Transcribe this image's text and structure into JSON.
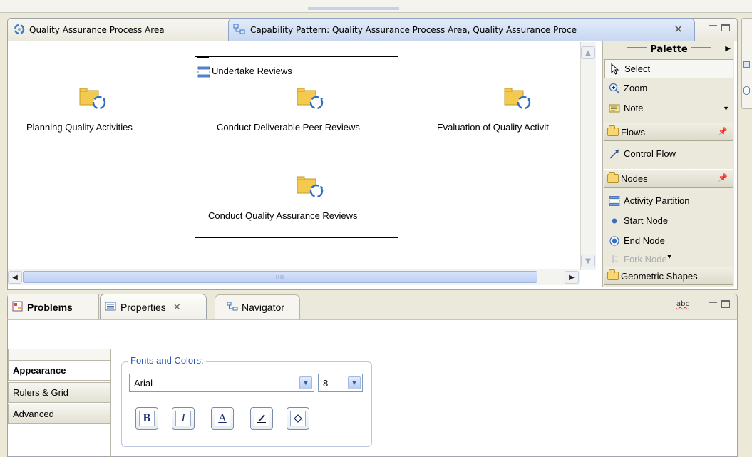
{
  "editor": {
    "tabs": [
      {
        "label": "Quality Assurance Process Area"
      },
      {
        "label": "Capability Pattern: Quality Assurance Process Area, Quality Assurance Proce"
      }
    ]
  },
  "diagram": {
    "nodes": [
      {
        "label": "Planning Quality Activities"
      },
      {
        "label": "Conduct Deliverable Peer Reviews"
      },
      {
        "label": "Conduct Quality Assurance Reviews"
      },
      {
        "label": "Evaluation of Quality Activit"
      }
    ],
    "partition": {
      "label": "Undertake Reviews"
    },
    "hscroll_grip": "IIII"
  },
  "palette": {
    "title": "Palette",
    "select": "Select",
    "zoom": "Zoom",
    "note": "Note",
    "flows": "Flows",
    "control_flow": "Control Flow",
    "nodes": "Nodes",
    "activity_partition": "Activity Partition",
    "start_node": "Start Node",
    "end_node": "End Node",
    "fork_node": "Fork Node",
    "geometric_shapes": "Geometric Shapes"
  },
  "bottom": {
    "tabs": [
      {
        "label": "Problems"
      },
      {
        "label": "Properties"
      },
      {
        "label": "Navigator"
      }
    ],
    "spell_icon_text": "abc"
  },
  "properties": {
    "sidebar": [
      "Appearance",
      "Rulers & Grid",
      "Advanced"
    ],
    "group_title": "Fonts and Colors:",
    "font": "Arial",
    "size": "8",
    "bold": "B",
    "italic": "I",
    "font_color": "A"
  },
  "colors": {
    "accent": "#316ac5",
    "folder": "#f6d774",
    "node_icon": "#f3c94e",
    "node_arrow": "#2e6fc4"
  }
}
